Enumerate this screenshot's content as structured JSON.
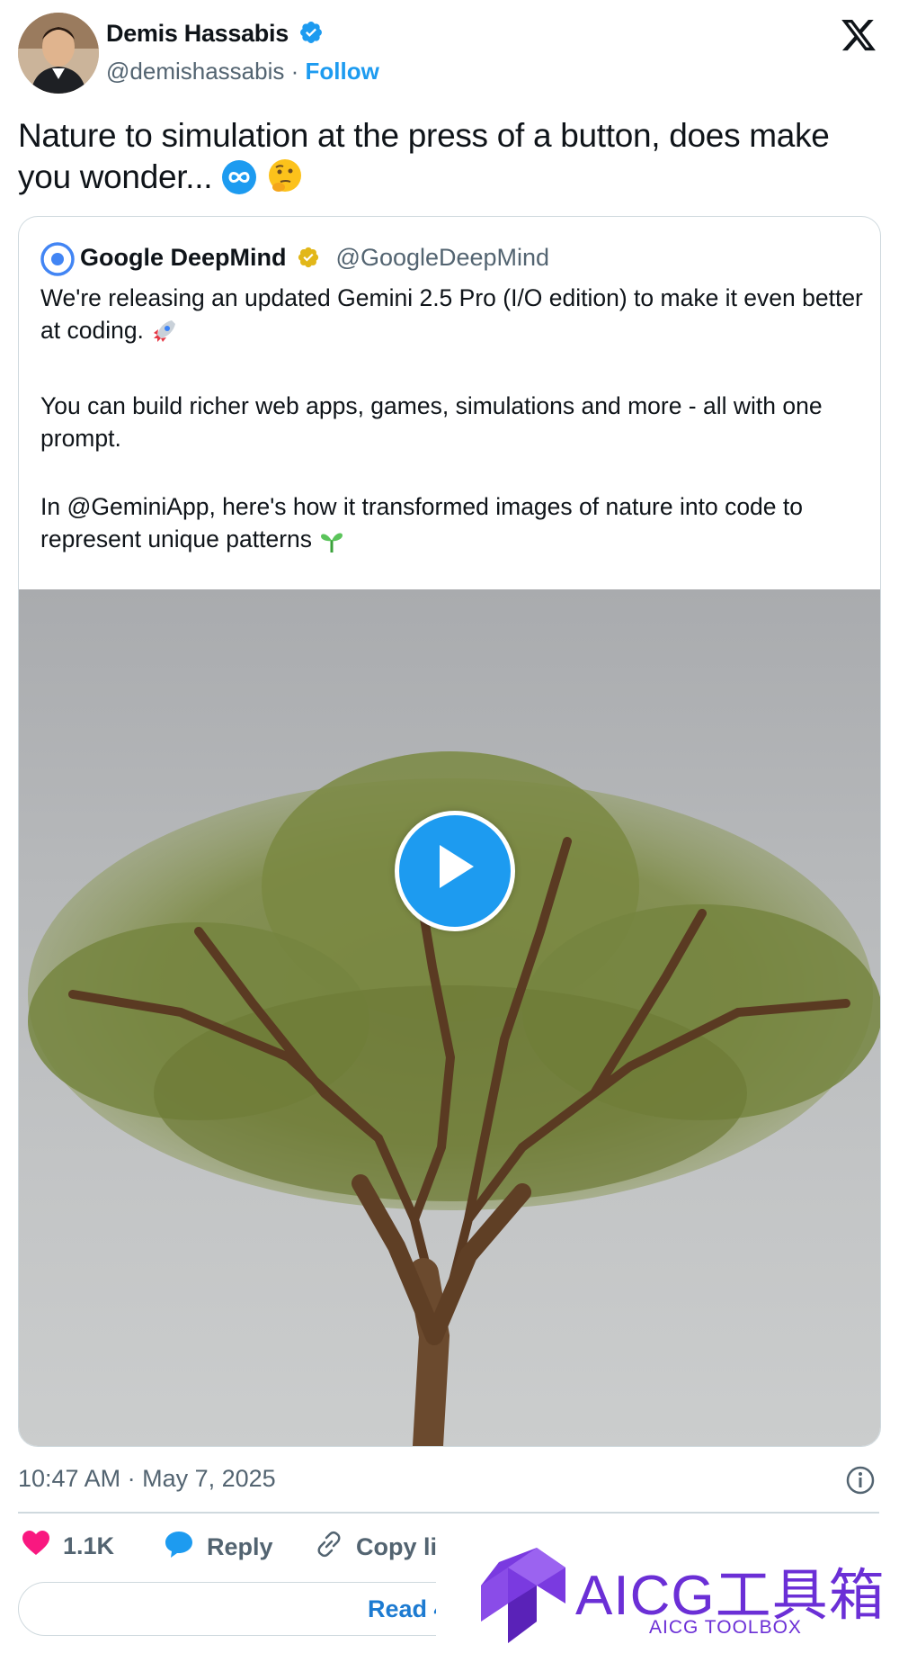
{
  "author": {
    "name": "Demis Hassabis",
    "handle": "@demishassabis",
    "separator": " · ",
    "follow_label": "Follow",
    "verified_color": "#1d9bf0"
  },
  "platform_logo": "x-logo-icon",
  "tweet": {
    "text": "Nature to simulation at the press of a button, does make you wonder...",
    "emojis": [
      "infinity-emoji",
      "thinking-face-emoji"
    ]
  },
  "quoted_tweet": {
    "author_name": "Google DeepMind",
    "author_handle": "@GoogleDeepMind",
    "verified_color": "#e2b719",
    "paragraphs": [
      "We're releasing an updated Gemini 2.5 Pro (I/O edition) to make it even better at coding.",
      "You can build richer web apps, games, simulations and more - all with one prompt.",
      "In @GeminiApp, here's how it transformed images of nature into code to represent unique patterns"
    ],
    "paragraph_emojis": [
      "rocket-emoji",
      "",
      "seedling-emoji"
    ],
    "media": {
      "type": "video",
      "subject": "tree-against-sky",
      "play_icon": "play-icon"
    }
  },
  "timestamp": "10:47 AM · May 7, 2025",
  "actions": {
    "like_count": "1.1K",
    "reply_label": "Reply",
    "copy_label": "Copy li"
  },
  "read_button_label": "Read 4",
  "watermark": {
    "title": "AICG工具箱",
    "subtitle": "AICG TOOLBOX",
    "color": "#6b2fd6"
  },
  "colors": {
    "accent": "#1d9bf0",
    "like": "#f91880",
    "border": "#cfd9de",
    "muted_text": "#536471"
  }
}
